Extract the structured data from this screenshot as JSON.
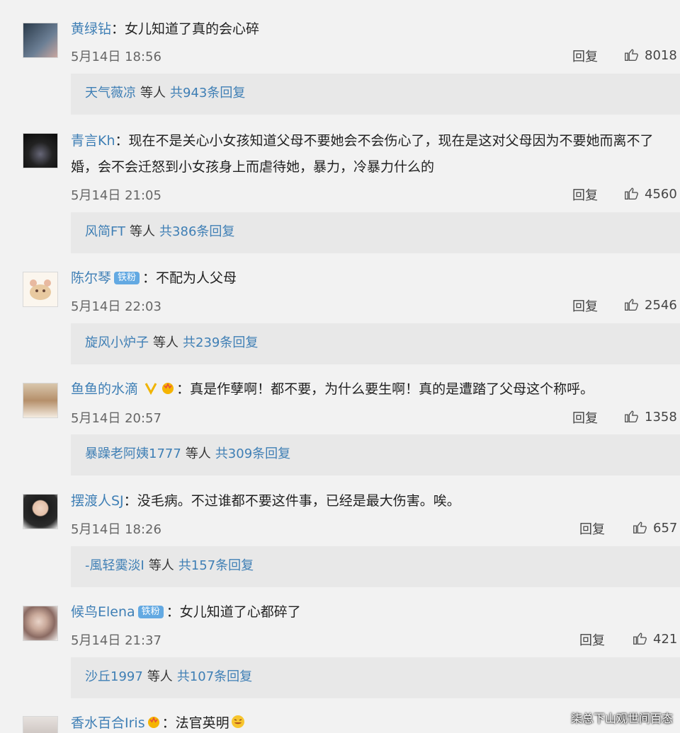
{
  "comments": [
    {
      "user": "黄绿钻",
      "text_line1": "女儿知道了真的会心碎",
      "text_line2": "",
      "time": "5月14日 18:56",
      "reply_label": "回复",
      "likes": "8018",
      "reply_summary": {
        "user": "天气薇凉",
        "mid": "等人",
        "count": "共943条回复"
      }
    },
    {
      "user": "青言Kh",
      "text_line1": "现在不是关心小女孩知道父母不要她会不会伤心了，现在是这对父母因为不要她而离不了",
      "text_line2": "婚，会不会迁怒到小女孩身上而虐待她，暴力，冷暴力什么的",
      "time": "5月14日 21:05",
      "reply_label": "回复",
      "likes": "4560",
      "reply_summary": {
        "user": "风简FT",
        "mid": "等人",
        "count": "共386条回复"
      }
    },
    {
      "user": "陈尔琴",
      "badge": "铁粉",
      "text_line1": "不配为人父母",
      "text_line2": "",
      "time": "5月14日 22:03",
      "reply_label": "回复",
      "likes": "2546",
      "reply_summary": {
        "user": "旋风小炉子",
        "mid": "等人",
        "count": "共239条回复"
      }
    },
    {
      "user": "鱼鱼的水滴",
      "text_line1": "真是作孽啊！都不要，为什么要生啊！真的是遭踏了父母这个称呼。",
      "text_line2": "",
      "time": "5月14日 20:57",
      "reply_label": "回复",
      "likes": "1358",
      "reply_summary": {
        "user": "暴躁老阿姨1777",
        "mid": "等人",
        "count": "共309条回复"
      }
    },
    {
      "user": "摆渡人SJ",
      "text_line1": "没毛病。不过谁都不要这件事，已经是最大伤害。唉。",
      "text_line2": "",
      "time": "5月14日 18:26",
      "reply_label": "回复",
      "likes": "657",
      "reply_summary": {
        "user": "-風轻霙淡I",
        "mid": "等人",
        "count": "共157条回复"
      }
    },
    {
      "user": "候鸟Elena",
      "badge": "铁粉",
      "text_line1": "女儿知道了心都碎了",
      "text_line2": "",
      "time": "5月14日 21:37",
      "reply_label": "回复",
      "likes": "421",
      "reply_summary": {
        "user": "沙丘1997",
        "mid": "等人",
        "count": "共107条回复"
      }
    },
    {
      "user": "香水百合Iris",
      "text_line1": "法官英明",
      "text_line2": ""
    }
  ],
  "watermark": "柒总下山观世间百态",
  "colors": {
    "username": "#3f7fb5",
    "background": "#f2f2f2",
    "reply_box": "#e8e8e8",
    "badge": "#63a9e2"
  }
}
